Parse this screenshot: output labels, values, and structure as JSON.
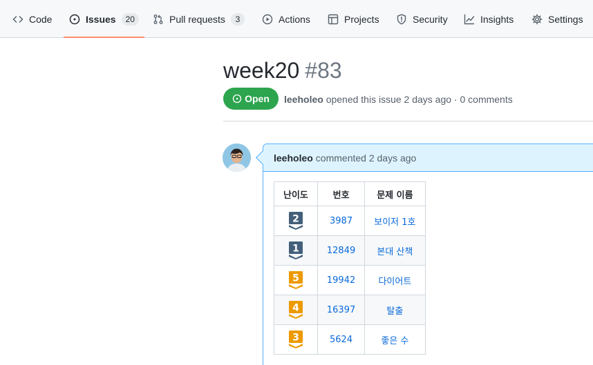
{
  "nav": {
    "items": [
      {
        "name": "code",
        "label": "Code",
        "icon": "code-icon"
      },
      {
        "name": "issues",
        "label": "Issues",
        "icon": "issue-opened-icon",
        "count": "20",
        "selected": true
      },
      {
        "name": "pull-requests",
        "label": "Pull requests",
        "icon": "git-pull-request-icon",
        "count": "3"
      },
      {
        "name": "actions",
        "label": "Actions",
        "icon": "play-icon"
      },
      {
        "name": "projects",
        "label": "Projects",
        "icon": "table-icon"
      },
      {
        "name": "security",
        "label": "Security",
        "icon": "shield-icon"
      },
      {
        "name": "insights",
        "label": "Insights",
        "icon": "graph-icon"
      },
      {
        "name": "settings",
        "label": "Settings",
        "icon": "gear-icon"
      }
    ]
  },
  "issue": {
    "title": "week20",
    "number": "#83",
    "state": "Open",
    "author": "leeholeo",
    "meta_rest": "opened this issue 2 days ago · 0 comments"
  },
  "comment": {
    "author": "leeholeo",
    "action": "commented 2 days ago"
  },
  "table": {
    "headers": [
      "난이도",
      "번호",
      "문제 이름"
    ],
    "rows": [
      {
        "tier": "2",
        "tier_color": "#435f7a",
        "number": "3987",
        "title": "보이저 1호"
      },
      {
        "tier": "1",
        "tier_color": "#435f7a",
        "number": "12849",
        "title": "본대 산책"
      },
      {
        "tier": "5",
        "tier_color": "#ec9a00",
        "number": "19942",
        "title": "다이어트"
      },
      {
        "tier": "4",
        "tier_color": "#ec9a00",
        "number": "16397",
        "title": "탈출"
      },
      {
        "tier": "3",
        "tier_color": "#ec9a00",
        "number": "5624",
        "title": "좋은 수"
      }
    ]
  },
  "colors": {
    "accent_link": "#0969da",
    "open_green": "#2da44e",
    "nav_underline": "#fd8c73",
    "comment_header_bg": "#ddf4ff"
  }
}
